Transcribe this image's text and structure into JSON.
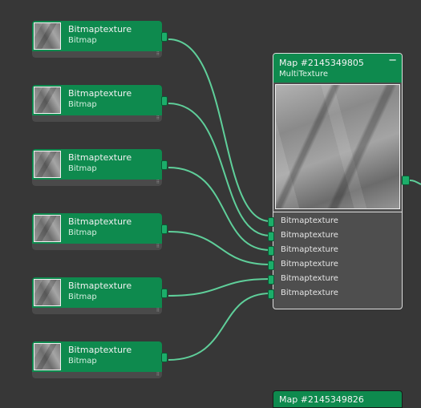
{
  "bitmap_nodes": [
    {
      "title": "Bitmaptexture",
      "subtitle": "Bitmap"
    },
    {
      "title": "Bitmaptexture",
      "subtitle": "Bitmap"
    },
    {
      "title": "Bitmaptexture",
      "subtitle": "Bitmap"
    },
    {
      "title": "Bitmaptexture",
      "subtitle": "Bitmap"
    },
    {
      "title": "Bitmaptexture",
      "subtitle": "Bitmap"
    },
    {
      "title": "Bitmaptexture",
      "subtitle": "Bitmap"
    }
  ],
  "multi_node": {
    "title": "Map #2145349805",
    "subtitle": "MultiTexture",
    "collapse_glyph": "−",
    "slots": [
      "Bitmaptexture",
      "Bitmaptexture",
      "Bitmaptexture",
      "Bitmaptexture",
      "Bitmaptexture",
      "Bitmaptexture"
    ]
  },
  "next_node": {
    "title": "Map #2145349826"
  },
  "colors": {
    "node_header": "#0e8a4e",
    "wire": "#5fcf9a",
    "background": "#373737"
  },
  "icons": {
    "grip": "resize-grip-icon",
    "collapse": "minus-icon"
  }
}
